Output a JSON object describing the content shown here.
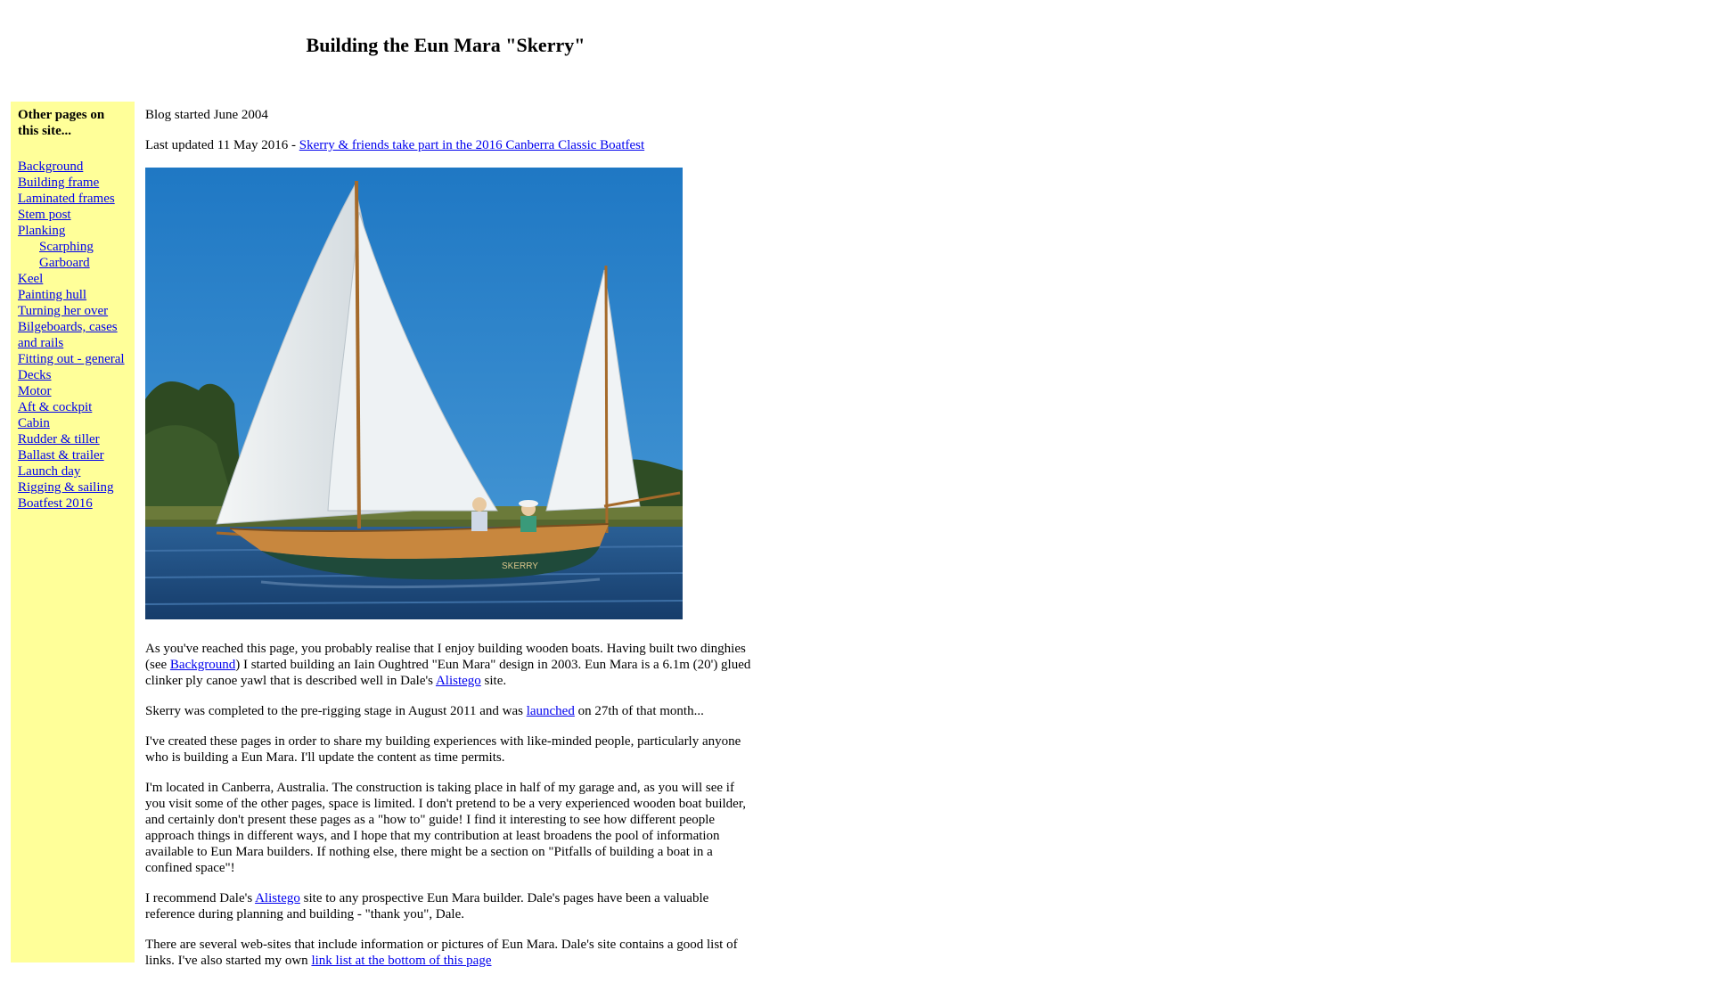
{
  "page": {
    "title": "Building the Eun Mara \"Skerry\""
  },
  "sidebar": {
    "heading": "Other pages on this site...",
    "items": [
      {
        "label": "Background",
        "sub": false
      },
      {
        "label": "Building frame",
        "sub": false
      },
      {
        "label": "Laminated frames",
        "sub": false
      },
      {
        "label": "Stem post",
        "sub": false
      },
      {
        "label": "Planking",
        "sub": false
      },
      {
        "label": "Scarphing",
        "sub": true
      },
      {
        "label": "Garboard",
        "sub": true
      },
      {
        "label": "Keel",
        "sub": false
      },
      {
        "label": "Painting hull",
        "sub": false
      },
      {
        "label": "Turning her over",
        "sub": false
      },
      {
        "label": "Bilgeboards, cases and rails",
        "sub": false
      },
      {
        "label": "Fitting out - general",
        "sub": false
      },
      {
        "label": "Decks",
        "sub": false
      },
      {
        "label": "Motor",
        "sub": false
      },
      {
        "label": "Aft & cockpit",
        "sub": false
      },
      {
        "label": "Cabin",
        "sub": false
      },
      {
        "label": "Rudder & tiller",
        "sub": false
      },
      {
        "label": "Ballast & trailer",
        "sub": false
      },
      {
        "label": "Launch day",
        "sub": false
      },
      {
        "label": "Rigging & sailing",
        "sub": false
      },
      {
        "label": "Boatfest 2016",
        "sub": false
      }
    ]
  },
  "main": {
    "blog_started": "Blog started June 2004",
    "last_updated_prefix": "Last updated 11 May 2016 - ",
    "last_updated_link": "Skerry & friends take part in the 2016 Canberra Classic Boatfest",
    "para1": {
      "t1": "As you've reached this page, you probably realise that I enjoy building wooden boats. Having built two dinghies (see ",
      "link1": "Background",
      "t2": ") I started building an Iain Oughtred \"Eun Mara\" design in 2003. Eun Mara is a 6.1m (20') glued clinker ply canoe yawl that is described well in Dale's ",
      "link2": "Alistego",
      "t3": " site."
    },
    "para2": {
      "t1": "Skerry was completed to the pre-rigging stage in August 2011 and was ",
      "link1": "launched",
      "t2": " on 27th of that month..."
    },
    "para3": "I've created these pages in order to share my building experiences with like-minded people, particularly anyone who is building a Eun Mara. I'll update the content as time permits.",
    "para4": "I'm located in Canberra, Australia. The construction is taking place in half of my garage and, as you will see if you visit some of the other pages, space is limited. I don't pretend to be a very experienced wooden boat builder, and certainly don't present these pages as a \"how to\" guide! I find it interesting to see how different people approach things in different ways, and I hope that my contribution at least broadens the pool of information available to Eun Mara builders. If nothing else, there might be a section on \"Pitfalls of building a boat in a confined space\"!",
    "para5": {
      "t1": "I recommend Dale's ",
      "link1": "Alistego",
      "t2": " site to any prospective Eun Mara builder. Dale's pages have been a valuable reference during planning and building - \"thank you\", Dale."
    },
    "para6": {
      "t1": "There are several web-sites that include information or pictures of Eun Mara. Dale's site contains a good list of links. I've also started my own ",
      "link1": "link list at the bottom of this page"
    },
    "photo": {
      "boat_name": "SKERRY"
    }
  },
  "colors": {
    "sidebar_bg": "#ffff99",
    "link": "#0000ee",
    "sky": "#2f86c8",
    "water": "#1f4f86",
    "hull_green": "#1f4a3a",
    "hull_wood": "#c8873e",
    "sail": "#e8eef2"
  }
}
